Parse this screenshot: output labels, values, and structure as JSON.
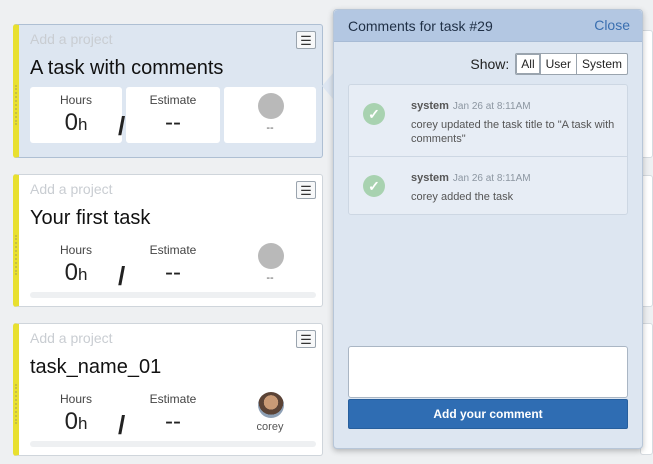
{
  "cards": [
    {
      "project_placeholder": "Add a project",
      "title": "A task with comments",
      "hours_label": "Hours",
      "hours_value": "0",
      "hours_unit": "h",
      "slash": "/",
      "estimate_label": "Estimate",
      "estimate_value": "--",
      "assignee": "--",
      "menu_icon": "hamburger-icon"
    },
    {
      "project_placeholder": "Add a project",
      "title": "Your first task",
      "hours_label": "Hours",
      "hours_value": "0",
      "hours_unit": "h",
      "slash": "/",
      "estimate_label": "Estimate",
      "estimate_value": "--",
      "assignee": "--",
      "menu_icon": "hamburger-icon"
    },
    {
      "project_placeholder": "Add a project",
      "title": "task_name_01",
      "hours_label": "Hours",
      "hours_value": "0",
      "hours_unit": "h",
      "slash": "/",
      "estimate_label": "Estimate",
      "estimate_value": "--",
      "assignee": "corey",
      "menu_icon": "hamburger-icon"
    }
  ],
  "panel": {
    "title": "Comments for task #29",
    "close_label": "Close",
    "show_label": "Show:",
    "filters": [
      "All",
      "User",
      "System"
    ],
    "active_filter": "All",
    "comments": [
      {
        "author": "system",
        "time": "Jan 26 at 8:11AM",
        "text": "corey updated the task title to \"A task with comments\"",
        "icon": "check-circle-icon"
      },
      {
        "author": "system",
        "time": "Jan 26 at 8:11AM",
        "text": "corey added the task",
        "icon": "check-circle-icon"
      }
    ],
    "comment_placeholder": "",
    "add_button_label": "Add your comment"
  },
  "colors": {
    "accent": "#2f6db3",
    "card_stripe": "#e8e030",
    "panel_bg": "#dde6f1",
    "panel_header": "#b3c7e2",
    "check_green": "#a8d2b0"
  }
}
